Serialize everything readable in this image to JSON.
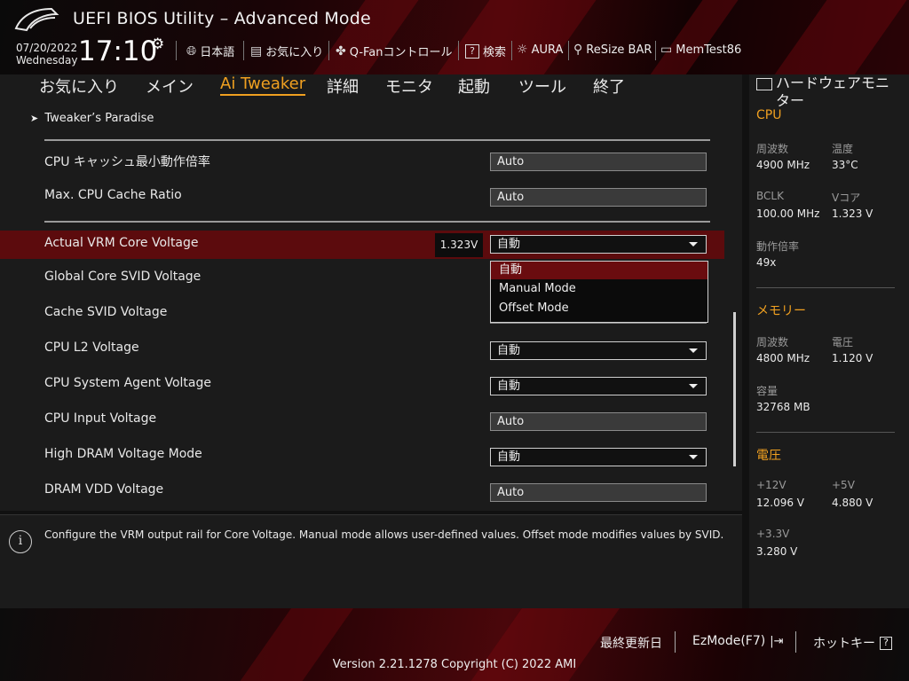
{
  "header": {
    "title": "UEFI BIOS Utility – Advanced Mode",
    "date": "07/20/2022",
    "weekday": "Wednesday",
    "time": "17:10",
    "tools": [
      {
        "label": "日本語",
        "icon": "globe-icon"
      },
      {
        "label": "お気に入り",
        "icon": "favorites-icon"
      },
      {
        "label": "Q-Fanコントロール",
        "icon": "fan-icon"
      },
      {
        "label": "検索",
        "icon": "search-icon"
      },
      {
        "label": "AURA",
        "icon": "aura-icon"
      },
      {
        "label": "ReSize BAR",
        "icon": "resize-bar-icon"
      },
      {
        "label": "MemTest86",
        "icon": "memtest-icon"
      }
    ]
  },
  "tabs": [
    {
      "label": "お気に入り"
    },
    {
      "label": "メイン"
    },
    {
      "label": "Ai Tweaker",
      "active": true
    },
    {
      "label": "詳細"
    },
    {
      "label": "モニタ"
    },
    {
      "label": "起動"
    },
    {
      "label": "ツール"
    },
    {
      "label": "終了"
    }
  ],
  "breadcrumb": "Tweaker’s Paradise",
  "settings": [
    {
      "label": "CPU キャッシュ最小動作倍率",
      "value": "Auto",
      "type": "text"
    },
    {
      "label": "Max. CPU Cache Ratio",
      "value": "Auto",
      "type": "text"
    },
    {
      "label": "Actual VRM Core Voltage",
      "value": "自動",
      "type": "dropdown",
      "readout": "1.323V",
      "selected": true
    },
    {
      "label": "Global Core SVID Voltage",
      "value": "",
      "type": "text"
    },
    {
      "label": "Cache SVID Voltage",
      "value": "",
      "type": "text"
    },
    {
      "label": "CPU L2 Voltage",
      "value": "自動",
      "type": "dropdown"
    },
    {
      "label": "CPU System Agent Voltage",
      "value": "自動",
      "type": "dropdown"
    },
    {
      "label": "CPU Input Voltage",
      "value": "Auto",
      "type": "text"
    },
    {
      "label": "High DRAM Voltage Mode",
      "value": "自動",
      "type": "dropdown"
    },
    {
      "label": "DRAM VDD Voltage",
      "value": "Auto",
      "type": "text"
    }
  ],
  "dropdown_options": [
    "自動",
    "Manual Mode",
    "Offset Mode"
  ],
  "help_text": "Configure the VRM output rail for Core Voltage. Manual mode allows user-defined values. Offset mode modifies values by SVID.",
  "hwmon": {
    "title": "ハードウェアモニター",
    "cpu": {
      "heading": "CPU",
      "freq_label": "周波数",
      "freq": "4900 MHz",
      "temp_label": "温度",
      "temp": "33°C",
      "bclk_label": "BCLK",
      "bclk": "100.00 MHz",
      "vcore_label": "Vコア",
      "vcore": "1.323 V",
      "ratio_label": "動作倍率",
      "ratio": "49x"
    },
    "memory": {
      "heading": "メモリー",
      "freq_label": "周波数",
      "freq": "4800 MHz",
      "volt_label": "電圧",
      "volt": "1.120 V",
      "cap_label": "容量",
      "cap": "32768 MB"
    },
    "voltage": {
      "heading": "電圧",
      "v12_label": "+12V",
      "v12": "12.096 V",
      "v5_label": "+5V",
      "v5": "4.880 V",
      "v33_label": "+3.3V",
      "v33": "3.280 V"
    }
  },
  "footer": {
    "last_modified": "最終更新日",
    "ezmode": "EzMode(F7)",
    "hotkeys": "ホットキー",
    "hotkey_glyph": "?",
    "version": "Version 2.21.1278 Copyright (C) 2022 AMI"
  },
  "colors": {
    "accent": "#f0a020",
    "selection": "#5c0b0d",
    "brand_red": "#8a0a10"
  }
}
